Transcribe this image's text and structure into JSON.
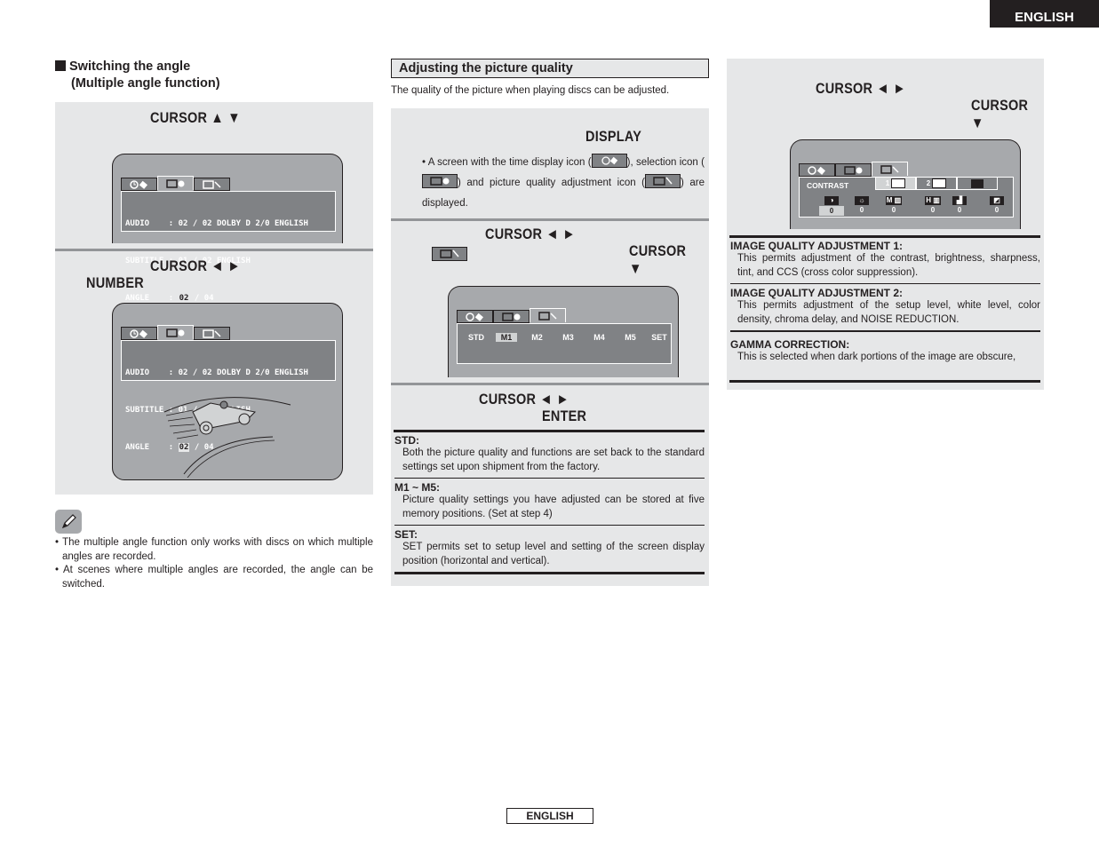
{
  "header": {
    "language_tab": "ENGLISH"
  },
  "footer": {
    "language_label": "ENGLISH"
  },
  "left": {
    "title_line1": "Switching the angle",
    "title_line2": "(Multiple angle function)",
    "step1": {
      "label": "CURSOR ▲      ▼"
    },
    "step2": {
      "label": "CURSOR ◄      ►",
      "label2": "NUMBER"
    },
    "osd": {
      "tabs": [
        "time-display-icon",
        "selection-icon",
        "picture-quality-icon"
      ],
      "rows": [
        {
          "name": "AUDIO   ",
          "value": ": 02 / 02 DOLBY D 2/0 ENGLISH"
        },
        {
          "name": "SUBTITLE",
          "value": ": 01 / 02 ENGLISH"
        },
        {
          "name": "ANGLE   ",
          "prefix": ": ",
          "highlight": "02",
          "suffix": " / 04"
        }
      ]
    },
    "notes": [
      "The multiple angle function only works with discs on which multiple angles are recorded.",
      "At scenes where multiple angles are recorded, the angle can be switched."
    ]
  },
  "middle": {
    "title": "Adjusting the picture quality",
    "intro": "The quality of the picture when playing discs can be adjusted.",
    "step1": {
      "label": "DISPLAY",
      "text_a": "A screen with the time display icon (",
      "text_b": "), selection icon (",
      "text_c": ") and picture quality adjustment icon (",
      "text_d": ") are displayed."
    },
    "step2": {
      "label": "CURSOR ◄      ►",
      "label2": "CURSOR ▼"
    },
    "menu": {
      "items": [
        "STD",
        "M1",
        "M2",
        "M3",
        "M4",
        "M5",
        "SET"
      ],
      "selected": "M1"
    },
    "step3": {
      "label": "CURSOR ◄      ►",
      "label2": "ENTER"
    },
    "definitions": [
      {
        "term": "STD:",
        "desc": "Both the picture quality and functions are set back to the standard settings set upon shipment from the factory."
      },
      {
        "term": "M1 ~ M5:",
        "desc": "Picture quality settings you have adjusted can be stored at five memory positions. (Set at step 4)"
      },
      {
        "term": "SET:",
        "desc": "SET permits set to setup level and setting of the screen display position (horizontal and vertical)."
      }
    ]
  },
  "right": {
    "step1": {
      "label": "CURSOR ◄      ►",
      "label2": "CURSOR ▼"
    },
    "osd": {
      "label": "CONTRAST",
      "mode_tabs": [
        "1",
        "2",
        ""
      ],
      "controls": [
        {
          "icon": "contrast-icon",
          "value": "0"
        },
        {
          "icon": "brightness-icon",
          "value": "0"
        },
        {
          "icon": "sharpness-m-icon",
          "prefix": "M",
          "value": "0"
        },
        {
          "icon": "sharpness-h-icon",
          "prefix": "H",
          "value": "0"
        },
        {
          "icon": "tint-icon",
          "value": "0"
        },
        {
          "icon": "ccs-icon",
          "value": "0"
        }
      ]
    },
    "definitions": [
      {
        "term": "IMAGE QUALITY ADJUSTMENT 1:",
        "desc": "This permits adjustment of the contrast, brightness, sharpness, tint, and CCS (cross color suppression)."
      },
      {
        "term": "IMAGE QUALITY ADJUSTMENT 2:",
        "desc": "This permits adjustment of the setup level, white level, color density, chroma delay, and NOISE REDUCTION."
      },
      {
        "term": "GAMMA CORRECTION:",
        "desc": "This is selected when dark portions of the image are obscure,"
      }
    ]
  }
}
